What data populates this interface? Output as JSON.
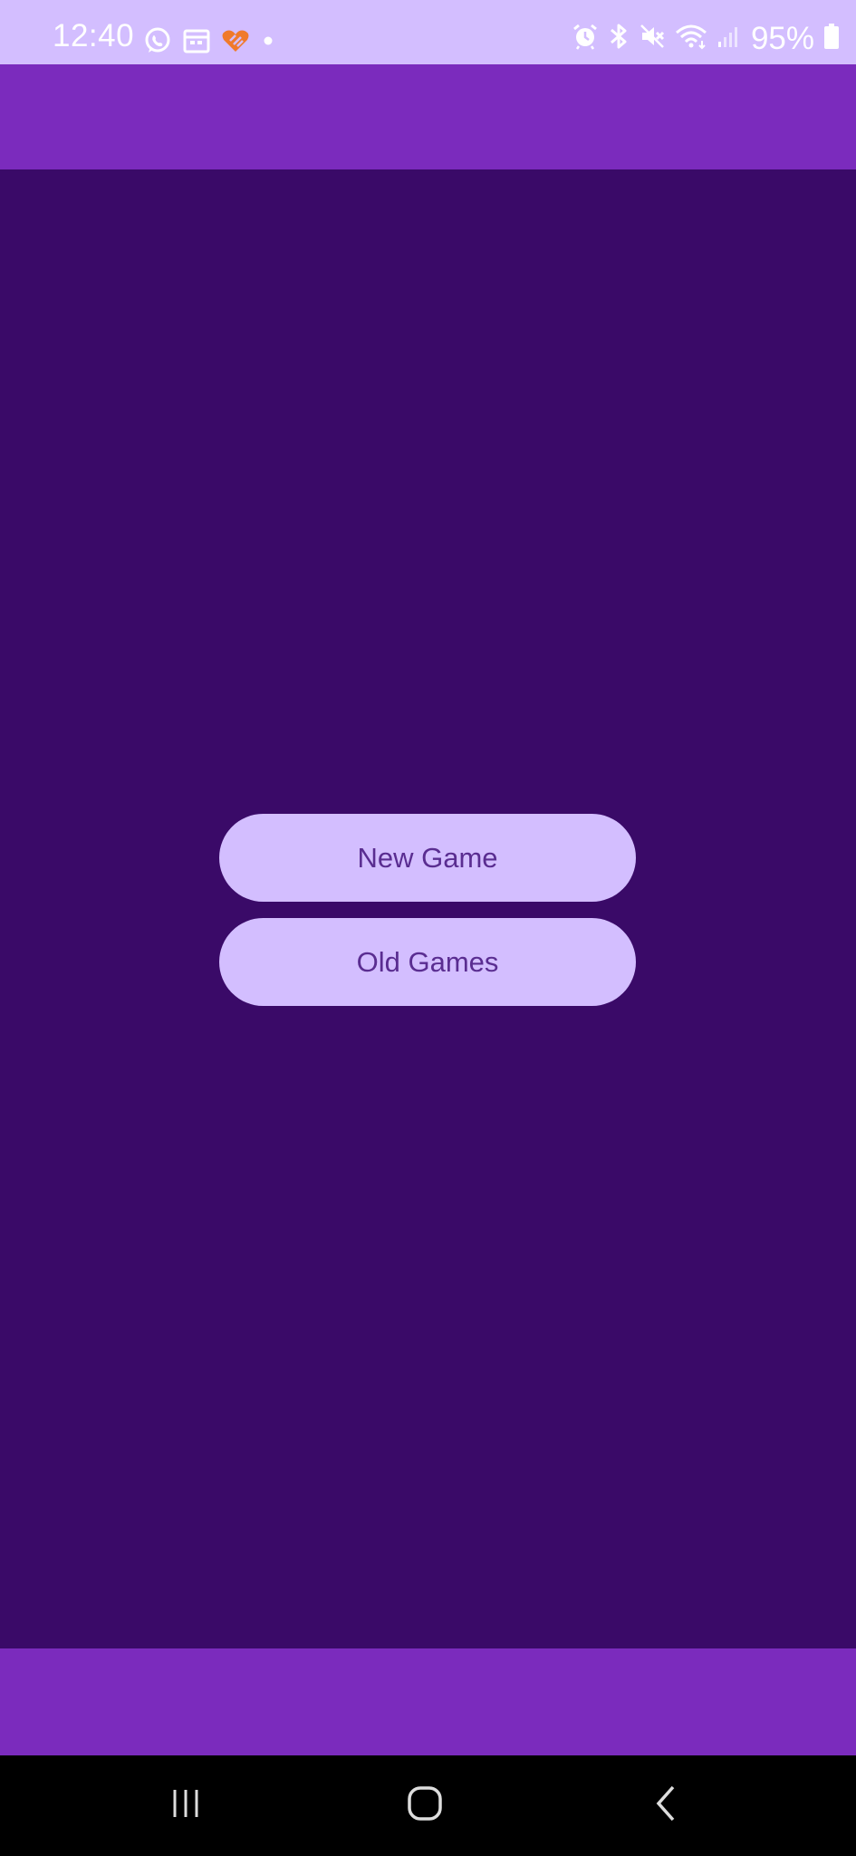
{
  "status_bar": {
    "time": "12:40",
    "battery_percent": "95%",
    "left_icons": [
      "whatsapp-icon",
      "calendar-icon",
      "app-heart-icon",
      "dot-icon"
    ],
    "right_icons": [
      "alarm-icon",
      "bluetooth-icon",
      "mute-icon",
      "wifi-icon",
      "signal-icon",
      "battery-icon"
    ]
  },
  "menu": {
    "new_game_label": "New Game",
    "old_games_label": "Old Games"
  },
  "nav_bar": {
    "icons": [
      "recent-apps-icon",
      "home-icon",
      "back-icon"
    ]
  },
  "colors": {
    "status_bar_bg": "#d3beff",
    "app_bar_bg": "#7b2bbd",
    "content_bg": "#3a0a68",
    "button_bg": "#d3beff",
    "button_text": "#5a2d91",
    "nav_bar_bg": "#000000",
    "accent_orange": "#f07a2a"
  }
}
